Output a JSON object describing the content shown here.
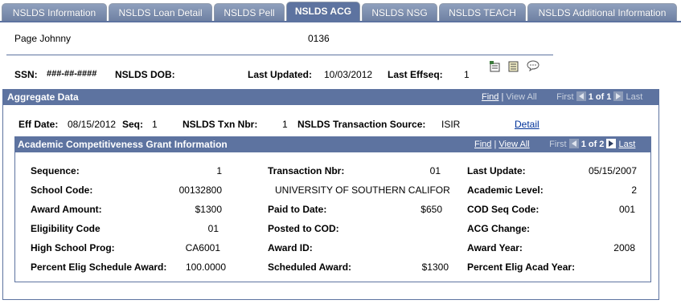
{
  "tabs": [
    {
      "label": "NSLDS Information",
      "active": false
    },
    {
      "label": "NSLDS Loan Detail",
      "active": false
    },
    {
      "label": "NSLDS Pell",
      "active": false
    },
    {
      "label": "NSLDS ACG",
      "active": true
    },
    {
      "label": "NSLDS NSG",
      "active": false
    },
    {
      "label": "NSLDS TEACH",
      "active": false
    },
    {
      "label": "NSLDS Additional Information",
      "active": false
    }
  ],
  "header": {
    "name": "Page Johnny",
    "id": "0136",
    "ssn_label": "SSN:",
    "ssn_value": "###-##-####",
    "dob_label": "NSLDS DOB:",
    "dob_value": "",
    "updated_label": "Last Updated:",
    "updated_value": "10/03/2012",
    "effseq_label": "Last Effseq:",
    "effseq_value": "1",
    "icons": [
      "notepad-icon",
      "checklist-icon",
      "comment-icon"
    ]
  },
  "aggregate": {
    "title": "Aggregate Data",
    "find": "Find",
    "sep": "|",
    "view_all": "View All",
    "first": "First",
    "page": "1 of 1",
    "last": "Last",
    "eff_date_label": "Eff Date:",
    "eff_date_value": "08/15/2012",
    "seq_label": "Seq:",
    "seq_value": "1",
    "txn_label": "NSLDS Txn Nbr:",
    "txn_value": "1",
    "source_label": "NSLDS Transaction Source:",
    "source_value": "ISIR",
    "detail": "Detail"
  },
  "acg": {
    "title": "Academic Competitiveness Grant Information",
    "find": "Find",
    "sep": "|",
    "view_all": "View All",
    "first": "First",
    "page": "1 of 2",
    "last": "Last",
    "col1": [
      {
        "label": "Sequence:",
        "value": "1"
      },
      {
        "label": "School Code:",
        "value": "00132800"
      },
      {
        "label": "Award Amount:",
        "value": "$1300"
      },
      {
        "label": "Eligibility Code",
        "value": "01"
      },
      {
        "label": "High School Prog:",
        "value": "CA6001"
      },
      {
        "label": "Percent Elig Schedule Award:",
        "value": "100.0000"
      }
    ],
    "col2": [
      {
        "label": "Transaction Nbr:",
        "value": "01"
      },
      {
        "label": "",
        "value": "UNIVERSITY OF SOUTHERN CALIFOR"
      },
      {
        "label": "Paid to Date:",
        "value": "$650"
      },
      {
        "label": "Posted to COD:",
        "value": ""
      },
      {
        "label": "Award ID:",
        "value": ""
      },
      {
        "label": "Scheduled Award:",
        "value": "$1300"
      }
    ],
    "col3": [
      {
        "label": "Last Update:",
        "value": "05/15/2007"
      },
      {
        "label": "Academic Level:",
        "value": "2"
      },
      {
        "label": "COD Seq Code:",
        "value": "001"
      },
      {
        "label": "ACG Change:",
        "value": ""
      },
      {
        "label": "Award Year:",
        "value": "2008"
      },
      {
        "label": "Percent Elig Acad Year:",
        "value": ""
      }
    ]
  }
}
